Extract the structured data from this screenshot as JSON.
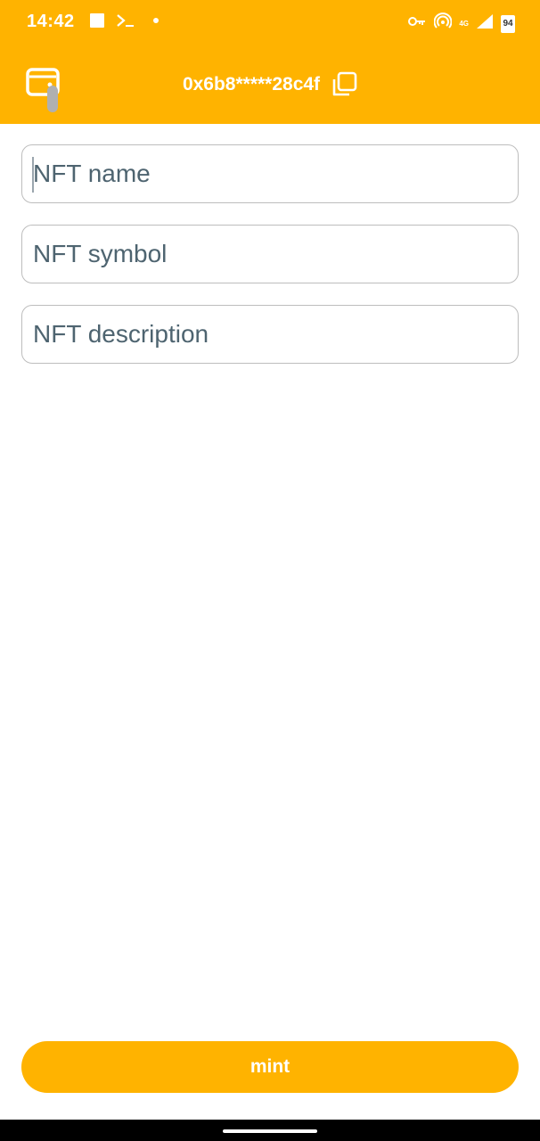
{
  "status_bar": {
    "time": "14:42",
    "network_label": "4G",
    "battery_level": "94",
    "left_icons": [
      "stop-square-icon",
      "terminal-icon",
      "dot-icon"
    ],
    "right_icons": [
      "vpn-key-icon",
      "hotspot-icon",
      "signal-icon",
      "battery-icon"
    ]
  },
  "app_bar": {
    "wallet_icon": "wallet-icon",
    "address": "0x6b8*****28c4f",
    "copy_icon": "copy-icon"
  },
  "form": {
    "name_placeholder": "NFT name",
    "symbol_placeholder": "NFT symbol",
    "description_placeholder": "NFT description"
  },
  "actions": {
    "mint_label": "mint"
  },
  "colors": {
    "accent": "#FFB300",
    "input_border": "#BDBDBD",
    "placeholder": "#4E6470"
  }
}
